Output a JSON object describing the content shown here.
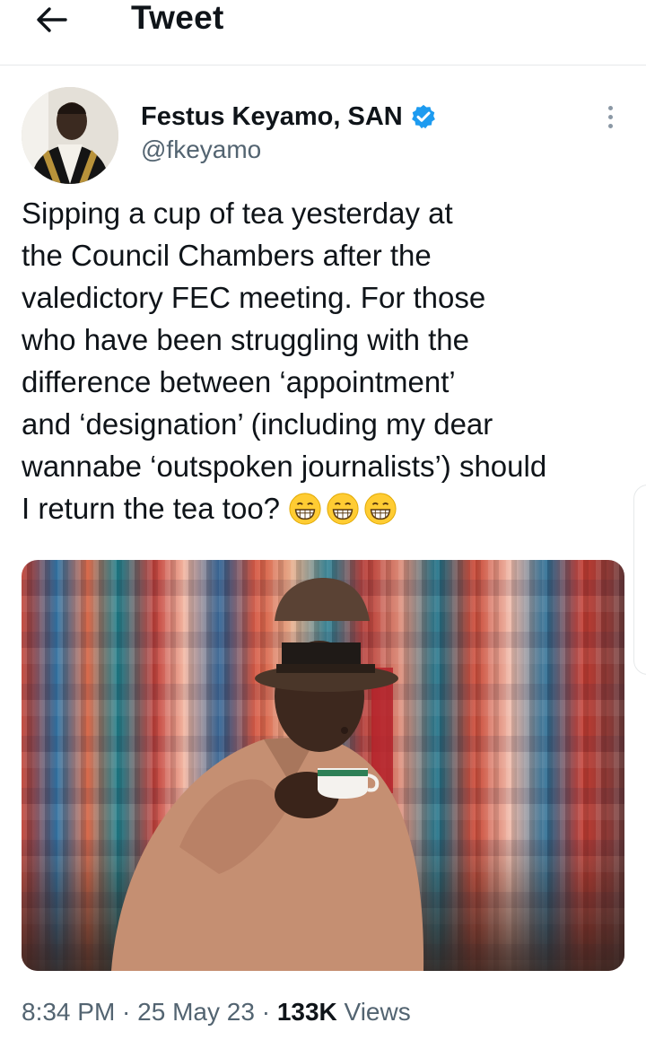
{
  "header": {
    "back_icon": "arrow-left-icon",
    "title": "Tweet"
  },
  "tweet": {
    "author": {
      "name": "Festus Keyamo, SAN",
      "handle": "@fkeyamo",
      "verified": true,
      "verified_icon": "verified-badge-icon",
      "verified_color": "#1d9bf0"
    },
    "more_icon": "more-vertical-icon",
    "text": "Sipping a cup of tea yesterday at\nthe Council Chambers after the\nvaledictory FEC meeting. For those\nwho have been struggling with the\ndifference between ‘appointment’\nand ‘designation’ (including my dear\nwannabe ‘outspoken journalists’) should\nI return the tea too? ",
    "emojis": [
      "grinning-face-emoji",
      "grinning-face-emoji",
      "grinning-face-emoji"
    ],
    "media_icon": "photo-man-sipping-tea",
    "meta": {
      "time": "8:34 PM",
      "sep1": " · ",
      "date": "25 May 23",
      "sep2": " · ",
      "views_count": "133K",
      "views_label": " Views"
    }
  },
  "colors": {
    "text": "#0f1419",
    "secondary": "#536471",
    "divider": "#e6e9ea"
  }
}
